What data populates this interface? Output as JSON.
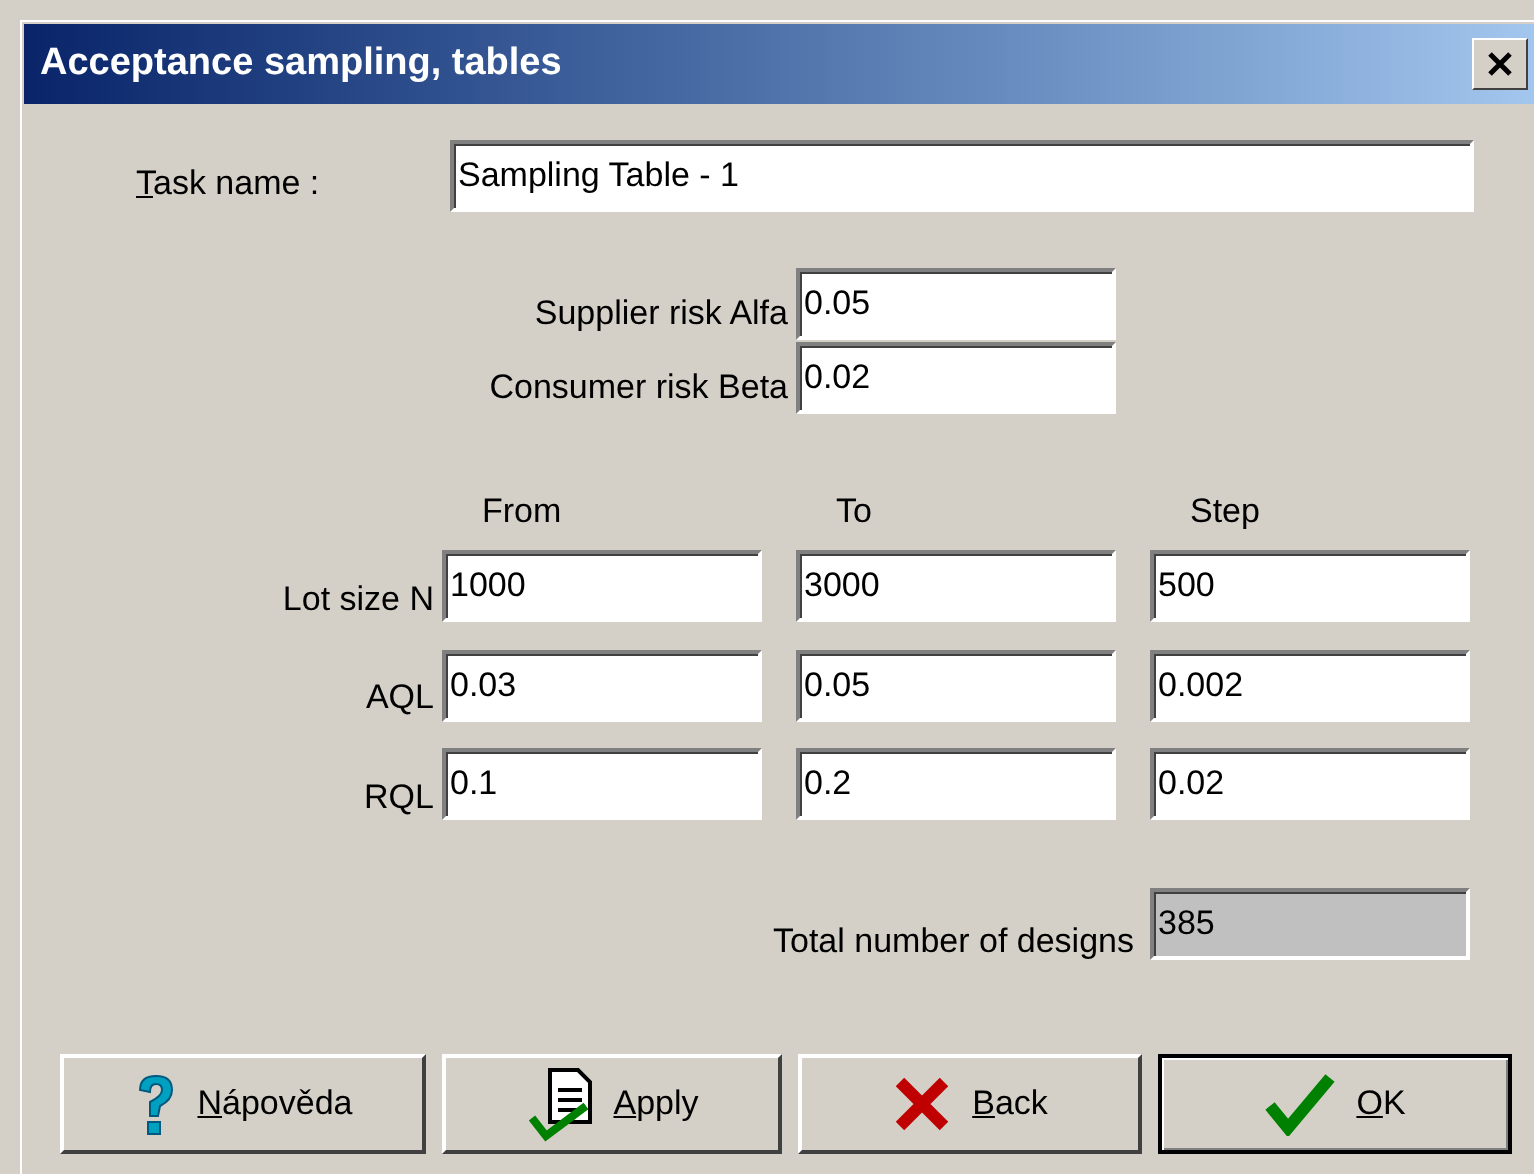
{
  "window": {
    "title": "Acceptance sampling, tables"
  },
  "task_name": {
    "label": "Task name :",
    "mnemonic": true,
    "value": "Sampling Table - 1"
  },
  "risks": [
    {
      "label": "Supplier risk Alfa",
      "value": "0.05"
    },
    {
      "label": "Consumer risk Beta",
      "value": "0.02"
    }
  ],
  "columns": [
    "From",
    "To",
    "Step"
  ],
  "rows": [
    {
      "label": "Lot size N",
      "values": [
        "1000",
        "3000",
        "500"
      ]
    },
    {
      "label": "AQL",
      "values": [
        "0.03",
        "0.05",
        "0.002"
      ]
    },
    {
      "label": "RQL",
      "values": [
        "0.1",
        "0.2",
        "0.02"
      ]
    }
  ],
  "total": {
    "label": "Total number of designs",
    "value": "385",
    "disabled": true
  },
  "buttons": [
    {
      "label": "Nápověda",
      "kind": "help",
      "mnemonic": true,
      "default": false
    },
    {
      "label": "Apply",
      "kind": "apply",
      "mnemonic": true,
      "default": false
    },
    {
      "label": "Back",
      "kind": "back",
      "mnemonic": true,
      "default": false
    },
    {
      "label": "OK",
      "kind": "ok",
      "mnemonic": true,
      "default": true
    }
  ]
}
